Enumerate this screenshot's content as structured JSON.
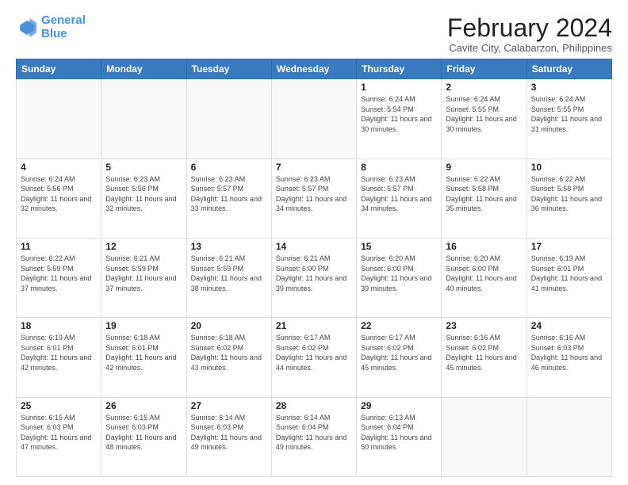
{
  "header": {
    "logo_line1": "General",
    "logo_line2": "Blue",
    "month_title": "February 2024",
    "subtitle": "Cavite City, Calabarzon, Philippines"
  },
  "weekdays": [
    "Sunday",
    "Monday",
    "Tuesday",
    "Wednesday",
    "Thursday",
    "Friday",
    "Saturday"
  ],
  "weeks": [
    [
      {
        "day": "",
        "info": ""
      },
      {
        "day": "",
        "info": ""
      },
      {
        "day": "",
        "info": ""
      },
      {
        "day": "",
        "info": ""
      },
      {
        "day": "1",
        "info": "Sunrise: 6:24 AM\nSunset: 5:54 PM\nDaylight: 11 hours and 30 minutes."
      },
      {
        "day": "2",
        "info": "Sunrise: 6:24 AM\nSunset: 5:55 PM\nDaylight: 11 hours and 30 minutes."
      },
      {
        "day": "3",
        "info": "Sunrise: 6:24 AM\nSunset: 5:55 PM\nDaylight: 11 hours and 31 minutes."
      }
    ],
    [
      {
        "day": "4",
        "info": "Sunrise: 6:24 AM\nSunset: 5:56 PM\nDaylight: 11 hours and 32 minutes."
      },
      {
        "day": "5",
        "info": "Sunrise: 6:23 AM\nSunset: 5:56 PM\nDaylight: 11 hours and 32 minutes."
      },
      {
        "day": "6",
        "info": "Sunrise: 6:23 AM\nSunset: 5:57 PM\nDaylight: 11 hours and 33 minutes."
      },
      {
        "day": "7",
        "info": "Sunrise: 6:23 AM\nSunset: 5:57 PM\nDaylight: 11 hours and 34 minutes."
      },
      {
        "day": "8",
        "info": "Sunrise: 6:23 AM\nSunset: 5:57 PM\nDaylight: 11 hours and 34 minutes."
      },
      {
        "day": "9",
        "info": "Sunrise: 6:22 AM\nSunset: 5:58 PM\nDaylight: 11 hours and 35 minutes."
      },
      {
        "day": "10",
        "info": "Sunrise: 6:22 AM\nSunset: 5:58 PM\nDaylight: 11 hours and 36 minutes."
      }
    ],
    [
      {
        "day": "11",
        "info": "Sunrise: 6:22 AM\nSunset: 5:59 PM\nDaylight: 11 hours and 37 minutes."
      },
      {
        "day": "12",
        "info": "Sunrise: 6:21 AM\nSunset: 5:59 PM\nDaylight: 11 hours and 37 minutes."
      },
      {
        "day": "13",
        "info": "Sunrise: 6:21 AM\nSunset: 5:59 PM\nDaylight: 11 hours and 38 minutes."
      },
      {
        "day": "14",
        "info": "Sunrise: 6:21 AM\nSunset: 6:00 PM\nDaylight: 11 hours and 39 minutes."
      },
      {
        "day": "15",
        "info": "Sunrise: 6:20 AM\nSunset: 6:00 PM\nDaylight: 11 hours and 39 minutes."
      },
      {
        "day": "16",
        "info": "Sunrise: 6:20 AM\nSunset: 6:00 PM\nDaylight: 11 hours and 40 minutes."
      },
      {
        "day": "17",
        "info": "Sunrise: 6:19 AM\nSunset: 6:01 PM\nDaylight: 11 hours and 41 minutes."
      }
    ],
    [
      {
        "day": "18",
        "info": "Sunrise: 6:19 AM\nSunset: 6:01 PM\nDaylight: 11 hours and 42 minutes."
      },
      {
        "day": "19",
        "info": "Sunrise: 6:18 AM\nSunset: 6:01 PM\nDaylight: 11 hours and 42 minutes."
      },
      {
        "day": "20",
        "info": "Sunrise: 6:18 AM\nSunset: 6:02 PM\nDaylight: 11 hours and 43 minutes."
      },
      {
        "day": "21",
        "info": "Sunrise: 6:17 AM\nSunset: 6:02 PM\nDaylight: 11 hours and 44 minutes."
      },
      {
        "day": "22",
        "info": "Sunrise: 6:17 AM\nSunset: 6:02 PM\nDaylight: 11 hours and 45 minutes."
      },
      {
        "day": "23",
        "info": "Sunrise: 6:16 AM\nSunset: 6:02 PM\nDaylight: 11 hours and 45 minutes."
      },
      {
        "day": "24",
        "info": "Sunrise: 6:16 AM\nSunset: 6:03 PM\nDaylight: 11 hours and 46 minutes."
      }
    ],
    [
      {
        "day": "25",
        "info": "Sunrise: 6:15 AM\nSunset: 6:03 PM\nDaylight: 11 hours and 47 minutes."
      },
      {
        "day": "26",
        "info": "Sunrise: 6:15 AM\nSunset: 6:03 PM\nDaylight: 11 hours and 48 minutes."
      },
      {
        "day": "27",
        "info": "Sunrise: 6:14 AM\nSunset: 6:03 PM\nDaylight: 11 hours and 49 minutes."
      },
      {
        "day": "28",
        "info": "Sunrise: 6:14 AM\nSunset: 6:04 PM\nDaylight: 11 hours and 49 minutes."
      },
      {
        "day": "29",
        "info": "Sunrise: 6:13 AM\nSunset: 6:04 PM\nDaylight: 11 hours and 50 minutes."
      },
      {
        "day": "",
        "info": ""
      },
      {
        "day": "",
        "info": ""
      }
    ]
  ]
}
